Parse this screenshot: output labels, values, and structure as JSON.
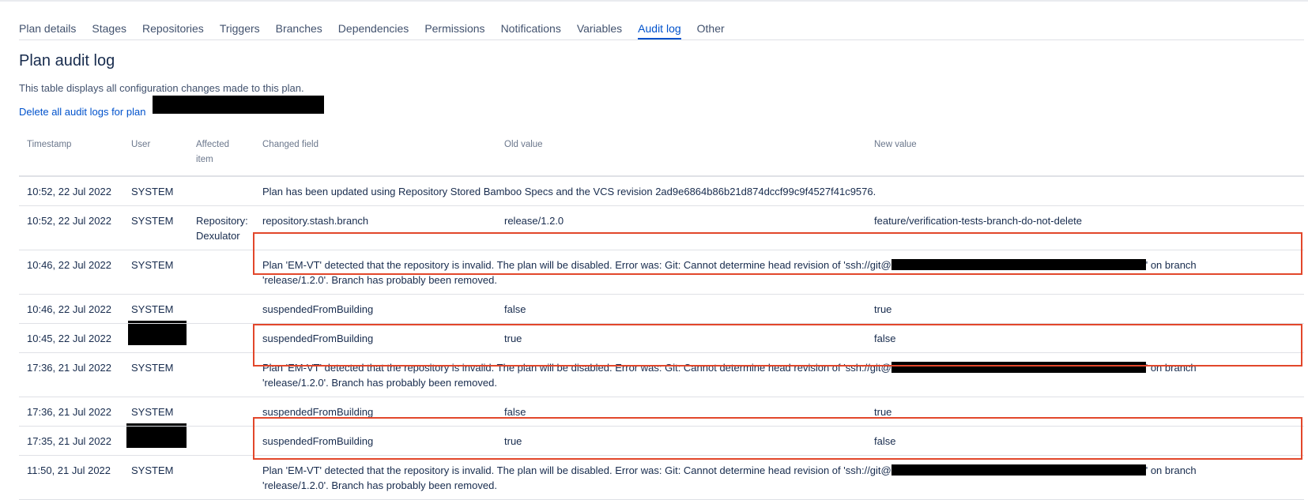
{
  "tabs": [
    {
      "label": "Plan details"
    },
    {
      "label": "Stages"
    },
    {
      "label": "Repositories"
    },
    {
      "label": "Triggers"
    },
    {
      "label": "Branches"
    },
    {
      "label": "Dependencies"
    },
    {
      "label": "Permissions"
    },
    {
      "label": "Notifications"
    },
    {
      "label": "Variables"
    },
    {
      "label": "Audit log",
      "active": true
    },
    {
      "label": "Other"
    }
  ],
  "page": {
    "title": "Plan audit log",
    "description": "This table displays all configuration changes made to this plan.",
    "delete_link": "Delete all audit logs for plan"
  },
  "table": {
    "headers": {
      "timestamp": "Timestamp",
      "user": "User",
      "affected_line1": "Affected",
      "affected_line2": "item",
      "changed_field": "Changed field",
      "old_value": "Old value",
      "new_value": "New value"
    },
    "rows": [
      {
        "timestamp": "10:52, 22 Jul 2022",
        "user": "SYSTEM",
        "affected": "",
        "message": "Plan has been updated using Repository Stored Bamboo Specs and the VCS revision 2ad9e6864b86b21d874dccf99c9f4527f41c9576."
      },
      {
        "timestamp": "10:52, 22 Jul 2022",
        "user": "SYSTEM",
        "affected_line1": "Repository:",
        "affected_line2": "Dexulator",
        "changed_field": "repository.stash.branch",
        "old_value": "release/1.2.0",
        "new_value": "feature/verification-tests-branch-do-not-delete"
      },
      {
        "timestamp": "10:46, 22 Jul 2022",
        "user": "SYSTEM",
        "affected": "",
        "msg_part1": "Plan 'EM-VT' detected that the repository is invalid. The plan will be disabled. Error was: Git: Cannot determine head revision of 'ssh://git@",
        "msg_part2": "' on branch",
        "msg_line2": "'release/1.2.0'. Branch has probably been removed."
      },
      {
        "timestamp": "10:46, 22 Jul 2022",
        "user": "SYSTEM",
        "affected": "",
        "changed_field": "suspendedFromBuilding",
        "old_value": "false",
        "new_value": "true"
      },
      {
        "timestamp": "10:45, 22 Jul 2022",
        "user": "",
        "affected": "",
        "changed_field": "suspendedFromBuilding",
        "old_value": "true",
        "new_value": "false"
      },
      {
        "timestamp": "17:36, 21 Jul 2022",
        "user": "SYSTEM",
        "affected": "",
        "msg_part1": "Plan 'EM-VT' detected that the repository is invalid. The plan will be disabled. Error was: Git: Cannot determine head revision of 'ssh://git@",
        "msg_part2": "' on branch",
        "msg_line2": "'release/1.2.0'. Branch has probably been removed."
      },
      {
        "timestamp": "17:36, 21 Jul 2022",
        "user": "SYSTEM",
        "affected": "",
        "changed_field": "suspendedFromBuilding",
        "old_value": "false",
        "new_value": "true"
      },
      {
        "timestamp": "17:35, 21 Jul 2022",
        "user": "",
        "affected": "",
        "changed_field": "suspendedFromBuilding",
        "old_value": "true",
        "new_value": "false"
      },
      {
        "timestamp": "11:50, 21 Jul 2022",
        "user": "SYSTEM",
        "affected": "",
        "msg_part1": "Plan 'EM-VT' detected that the repository is invalid. The plan will be disabled. Error was: Git: Cannot determine head revision of 'ssh://git@",
        "msg_part2": "' on branch",
        "msg_line2": "'release/1.2.0'. Branch has probably been removed."
      }
    ]
  },
  "colors": {
    "link": "#0052cc",
    "highlight": "#e2472b",
    "redaction": "#000000"
  }
}
